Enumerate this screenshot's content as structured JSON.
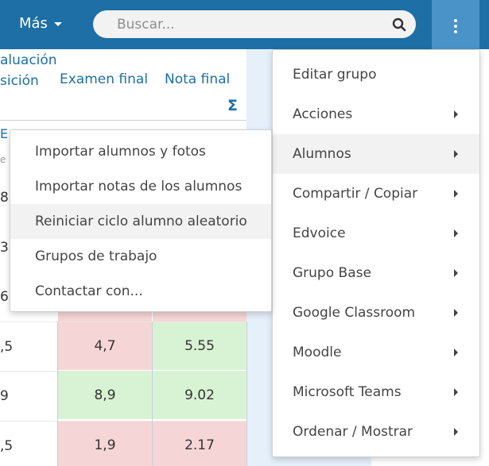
{
  "navbar": {
    "mas_label": "Más",
    "search_placeholder": "Buscar..."
  },
  "table": {
    "headers": {
      "evaluacion_line1": "aluación",
      "evaluacion_line2": "sición",
      "examen_final": "Examen final",
      "nota_final": "Nota final",
      "sigma": "Σ"
    },
    "partial_letters": [
      "E",
      "e"
    ],
    "hidden_rows_left": [
      "8",
      "3",
      "6"
    ],
    "rows": [
      {
        "left": ",5",
        "examen": "4,7",
        "nota": "5.55",
        "examen_color": "red",
        "nota_color": "green"
      },
      {
        "left": "9",
        "examen": "8,9",
        "nota": "9.02",
        "examen_color": "green",
        "nota_color": "green"
      },
      {
        "left": ",5",
        "examen": "1,9",
        "nota": "2.17",
        "examen_color": "red",
        "nota_color": "red"
      }
    ]
  },
  "submenu": {
    "items": [
      "Importar alumnos y fotos",
      "Importar notas de los alumnos",
      "Reiniciar ciclo alumno aleatorio",
      "Grupos de trabajo",
      "Contactar con..."
    ],
    "highlighted_index": 2
  },
  "dropdown": {
    "items": [
      {
        "label": "Editar grupo",
        "has_submenu": false
      },
      {
        "label": "Acciones",
        "has_submenu": true
      },
      {
        "label": "Alumnos",
        "has_submenu": true
      },
      {
        "label": "Compartir / Copiar",
        "has_submenu": true
      },
      {
        "label": "Edvoice",
        "has_submenu": true
      },
      {
        "label": "Grupo Base",
        "has_submenu": true
      },
      {
        "label": "Google Classroom",
        "has_submenu": true
      },
      {
        "label": "Moodle",
        "has_submenu": true
      },
      {
        "label": "Microsoft Teams",
        "has_submenu": true
      },
      {
        "label": "Ordenar / Mostrar",
        "has_submenu": true
      }
    ],
    "highlighted_index": 2
  },
  "colors": {
    "navbar": "#1d6fa5",
    "kebab_active": "#4a93c8",
    "link": "#1d6fa5",
    "cell_red": "#f5d5d5",
    "cell_green": "#d8f3d3",
    "column_blue": "#e6f0fb"
  },
  "icons": [
    "search-icon",
    "kebab-menu-icon",
    "caret-down-icon",
    "chevron-right-icon",
    "sigma-icon"
  ]
}
